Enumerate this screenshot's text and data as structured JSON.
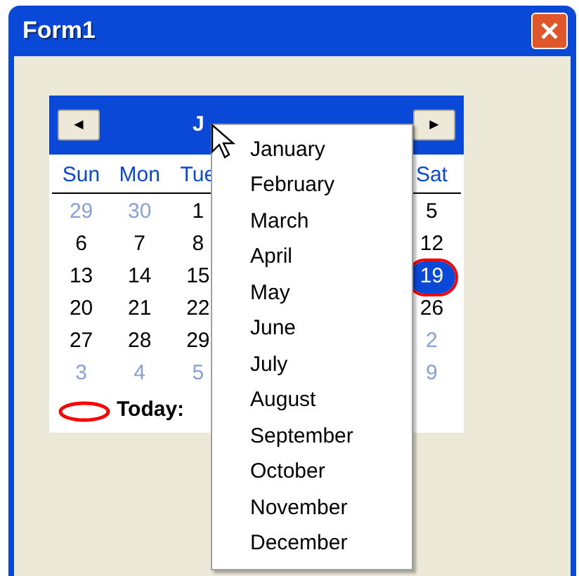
{
  "window": {
    "title": "Form1"
  },
  "calendar": {
    "title_visible": "J",
    "prev": "◄",
    "next": "►",
    "weekdays": {
      "sun": "Sun",
      "mon": "Mon",
      "tue": "Tue",
      "sat": "Sat"
    },
    "weeks": [
      {
        "sun": {
          "text": "29",
          "other_month": true,
          "selected": false
        },
        "mon": {
          "text": "30",
          "other_month": true,
          "selected": false
        },
        "tue": {
          "text": "1",
          "other_month": false,
          "selected": false
        },
        "sat": {
          "text": "5",
          "other_month": false,
          "selected": false
        }
      },
      {
        "sun": {
          "text": "6",
          "other_month": false,
          "selected": false
        },
        "mon": {
          "text": "7",
          "other_month": false,
          "selected": false
        },
        "tue": {
          "text": "8",
          "other_month": false,
          "selected": false
        },
        "sat": {
          "text": "12",
          "other_month": false,
          "selected": false
        }
      },
      {
        "sun": {
          "text": "13",
          "other_month": false,
          "selected": false
        },
        "mon": {
          "text": "14",
          "other_month": false,
          "selected": false
        },
        "tue": {
          "text": "15",
          "other_month": false,
          "selected": false
        },
        "sat": {
          "text": "19",
          "other_month": false,
          "selected": true
        }
      },
      {
        "sun": {
          "text": "20",
          "other_month": false,
          "selected": false
        },
        "mon": {
          "text": "21",
          "other_month": false,
          "selected": false
        },
        "tue": {
          "text": "22",
          "other_month": false,
          "selected": false
        },
        "sat": {
          "text": "26",
          "other_month": false,
          "selected": false
        }
      },
      {
        "sun": {
          "text": "27",
          "other_month": false,
          "selected": false
        },
        "mon": {
          "text": "28",
          "other_month": false,
          "selected": false
        },
        "tue": {
          "text": "29",
          "other_month": false,
          "selected": false
        },
        "sat": {
          "text": "2",
          "other_month": true,
          "selected": false
        }
      },
      {
        "sun": {
          "text": "3",
          "other_month": true,
          "selected": false
        },
        "mon": {
          "text": "4",
          "other_month": true,
          "selected": false
        },
        "tue": {
          "text": "5",
          "other_month": true,
          "selected": false
        },
        "sat": {
          "text": "9",
          "other_month": true,
          "selected": false
        }
      }
    ],
    "today_label": "Today:"
  },
  "month_menu": [
    "January",
    "February",
    "March",
    "April",
    "May",
    "June",
    "July",
    "August",
    "September",
    "October",
    "November",
    "December"
  ]
}
